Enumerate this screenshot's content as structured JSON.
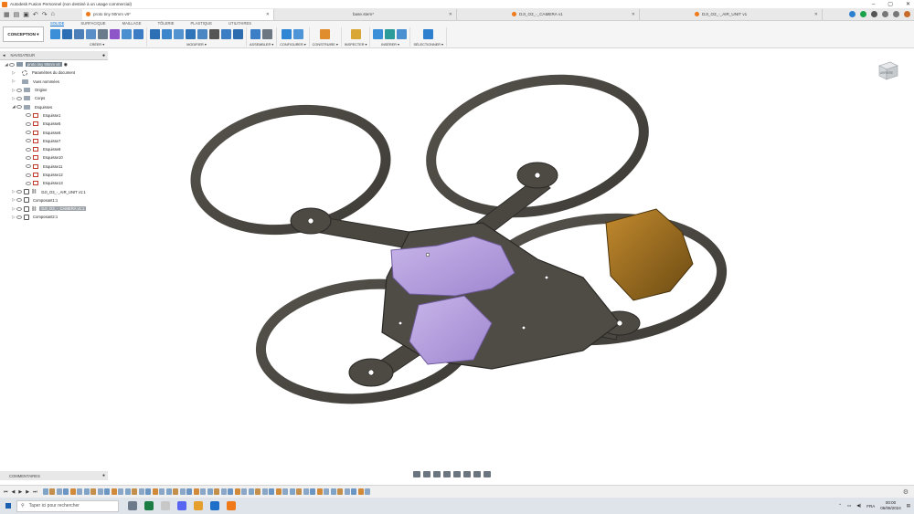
{
  "window": {
    "title": "Autodesk Fusion Personnel (non destiné à un usage commercial)"
  },
  "tabs": [
    {
      "label": "proto tiny 90mm v8*",
      "active": true
    },
    {
      "label": "base.stem*",
      "active": false
    },
    {
      "label": "DJI_O3_-_CAMERA v1",
      "active": false
    },
    {
      "label": "DJI_O3_-_AIR_UNIT v1",
      "active": false
    }
  ],
  "ribbon": {
    "mode": "CONCEPTION",
    "tabs": [
      "SOLIDE",
      "SURFACIQUE",
      "MAILLAGE",
      "TÔLERIE",
      "PLASTIQUE",
      "UTILITAIRES"
    ],
    "active_tab": "SOLIDE",
    "groups": [
      {
        "label": "CRÉER ▾",
        "count": 8
      },
      {
        "label": "MODIFIER ▾",
        "count": 9
      },
      {
        "label": "ASSEMBLER ▾",
        "count": 2
      },
      {
        "label": "CONFIGURER ▾",
        "count": 2
      },
      {
        "label": "CONSTRUIRE ▾",
        "count": 1
      },
      {
        "label": "INSPECTER ▾",
        "count": 1
      },
      {
        "label": "INSÉRER ▾",
        "count": 3
      },
      {
        "label": "SÉLECTIONNER ▾",
        "count": 1
      }
    ],
    "colors": {
      "accent": "#0a6fd0"
    }
  },
  "browser": {
    "title": "NAVIGATEUR",
    "items": [
      {
        "label": "proto tiny 90mm v8",
        "kind": "root",
        "depth": 0,
        "expanded": true
      },
      {
        "label": "Paramètres du document",
        "kind": "gear",
        "depth": 1
      },
      {
        "label": "Vues nommées",
        "kind": "folder",
        "depth": 1
      },
      {
        "label": "Origine",
        "kind": "folder",
        "depth": 1
      },
      {
        "label": "Corps",
        "kind": "folder",
        "depth": 1
      },
      {
        "label": "Esquisses",
        "kind": "folder",
        "depth": 1,
        "expanded": true
      },
      {
        "label": "Esquisse1",
        "kind": "sketch",
        "depth": 2
      },
      {
        "label": "Esquisse5",
        "kind": "sketch",
        "depth": 2
      },
      {
        "label": "Esquisse6",
        "kind": "sketch",
        "depth": 2
      },
      {
        "label": "Esquisse7",
        "kind": "sketch",
        "depth": 2
      },
      {
        "label": "Esquisse8",
        "kind": "sketch",
        "depth": 2
      },
      {
        "label": "Esquisse10",
        "kind": "sketch",
        "depth": 2
      },
      {
        "label": "Esquisse11",
        "kind": "sketch",
        "depth": 2
      },
      {
        "label": "Esquisse12",
        "kind": "sketch",
        "depth": 2
      },
      {
        "label": "Esquisse13",
        "kind": "sketch",
        "depth": 2
      },
      {
        "label": "DJI_O3_-_AIR_UNIT v1:1",
        "kind": "link",
        "depth": 1
      },
      {
        "label": "Composant1:1",
        "kind": "component",
        "depth": 1
      },
      {
        "label": "DJI_O3_-_CAMERA v1:1",
        "kind": "link",
        "depth": 1,
        "selected": true
      },
      {
        "label": "Composant2:1",
        "kind": "component",
        "depth": 1
      }
    ]
  },
  "comments": {
    "label": "COMMENTAIRES"
  },
  "viewcube": {
    "label": "ARRIÈRE"
  },
  "taskbar": {
    "search_placeholder": "Taper ici pour rechercher",
    "language": "FRA",
    "time": "00:00",
    "date": "06/08/2024"
  }
}
